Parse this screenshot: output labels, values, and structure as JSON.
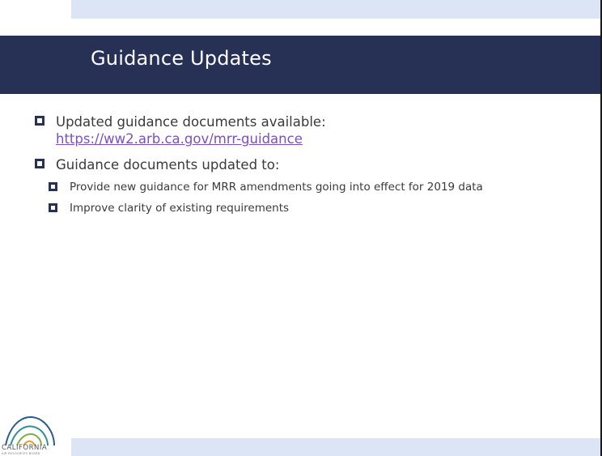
{
  "slide": {
    "title": "Guidance Updates",
    "bullets": [
      {
        "text": "Updated guidance documents available:",
        "link": "https://ww2.arb.ca.gov/mrr-guidance"
      },
      {
        "text": "Guidance documents updated to:",
        "subbullets": [
          {
            "text": "Provide new guidance for MRR amendments going into effect for 2019 data"
          },
          {
            "text": "Improve clarity of existing requirements"
          }
        ]
      }
    ]
  },
  "logo": {
    "text": "CALIFORNIA",
    "subtext": "AIR RESOURCES BOARD"
  },
  "colors": {
    "title_bar": "#273156",
    "accent_strip": "#dbe5f5",
    "link": "#7a4fc4",
    "body_text": "#3a3a3a"
  }
}
